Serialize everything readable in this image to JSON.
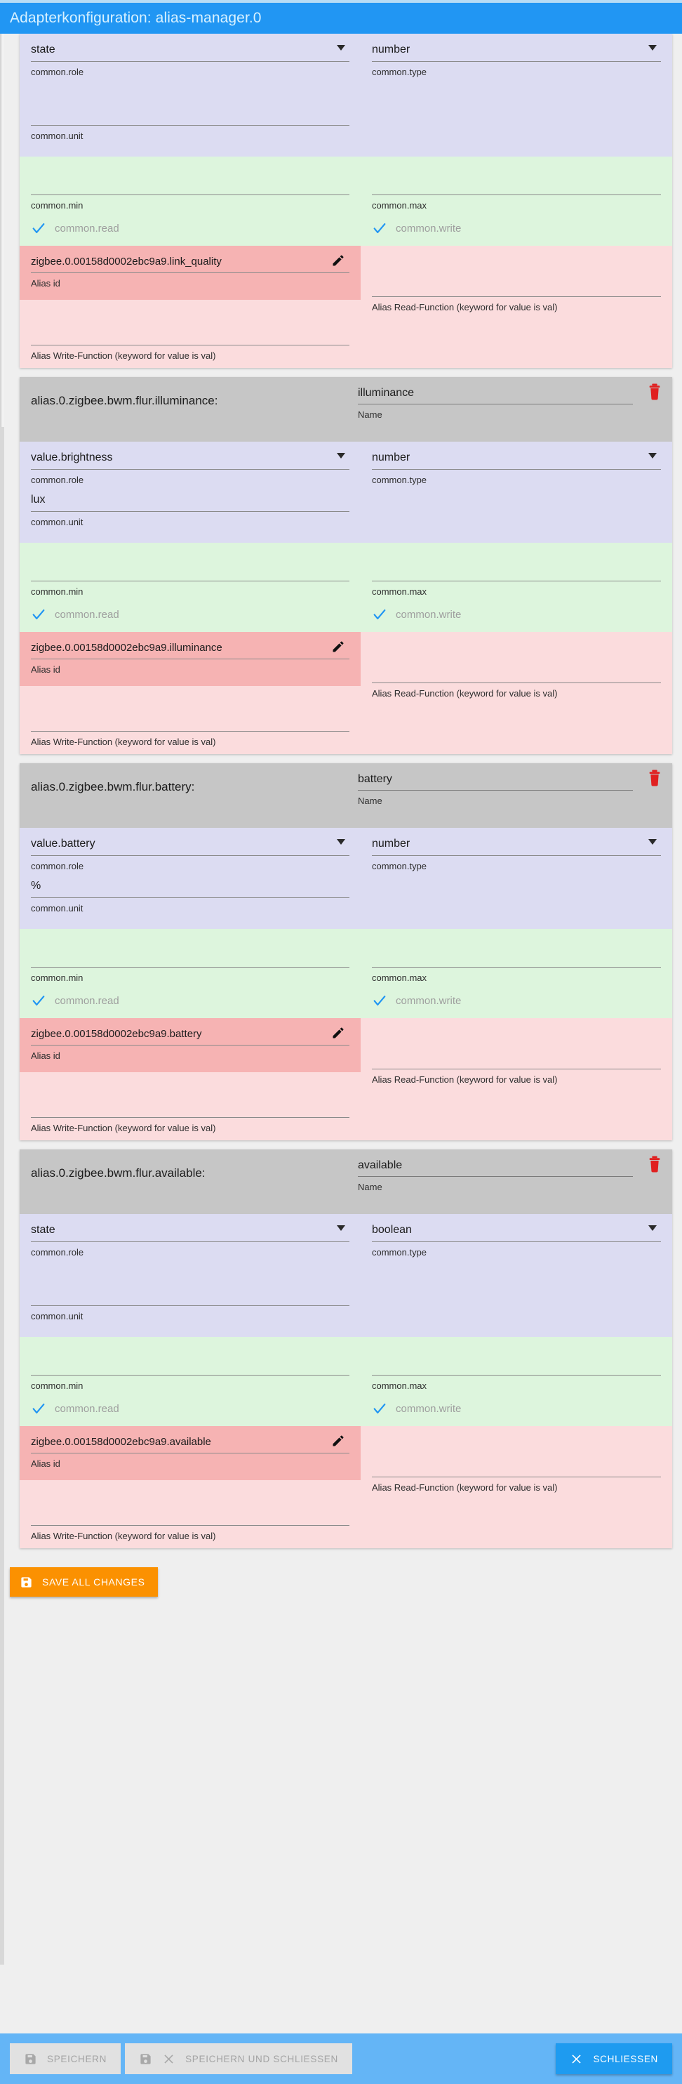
{
  "window": {
    "title": "Adapterkonfiguration: alias-manager.0"
  },
  "labels": {
    "role": "common.role",
    "type": "common.type",
    "unit": "common.unit",
    "min": "common.min",
    "max": "common.max",
    "read": "common.read",
    "write": "common.write",
    "name": "Name",
    "alias_id": "Alias id",
    "alias_read_fn": "Alias Read-Function (keyword for value is val)",
    "alias_write_fn": "Alias Write-Function (keyword for value is val)"
  },
  "icons": {
    "delete": "trash-icon",
    "edit": "pencil-icon",
    "check": "check-icon",
    "save": "floppy-disk-icon",
    "close": "close-x-icon"
  },
  "colors": {
    "accent": "#2196f3",
    "titlebar": "#2196f3",
    "bottombar": "#64b5f6",
    "save_all": "#fb9101",
    "card_head": "#c6c6c6",
    "band_violet": "#dcdcf2",
    "band_green": "#ddf5dd",
    "band_red_light": "#fbdcdd",
    "alias_box": "#f6b3b3",
    "trash_red": "#e02020",
    "check_blue": "#2196f3",
    "close_button": "#1e9bf0"
  },
  "cards": [
    {
      "id": "card-partial",
      "partial": true,
      "header_path": "",
      "name": "",
      "role": "state",
      "type": "number",
      "unit": "",
      "min": "",
      "max": "",
      "read": true,
      "write": true,
      "alias_id": "zigbee.0.00158d0002ebc9a9.link_quality",
      "read_function": "",
      "write_function": ""
    },
    {
      "id": "card-illuminance",
      "partial": false,
      "header_path": "alias.0.zigbee.bwm.flur.illuminance:",
      "name": "illuminance",
      "role": "value.brightness",
      "type": "number",
      "unit": "lux",
      "min": "",
      "max": "",
      "read": true,
      "write": true,
      "alias_id": "zigbee.0.00158d0002ebc9a9.illuminance",
      "read_function": "",
      "write_function": ""
    },
    {
      "id": "card-battery",
      "partial": false,
      "header_path": "alias.0.zigbee.bwm.flur.battery:",
      "name": "battery",
      "role": "value.battery",
      "type": "number",
      "unit": "%",
      "min": "",
      "max": "",
      "read": true,
      "write": true,
      "alias_id": "zigbee.0.00158d0002ebc9a9.battery",
      "read_function": "",
      "write_function": ""
    },
    {
      "id": "card-available",
      "partial": false,
      "header_path": "alias.0.zigbee.bwm.flur.available:",
      "name": "available",
      "role": "state",
      "type": "boolean",
      "unit": "",
      "min": "",
      "max": "",
      "read": true,
      "write": true,
      "alias_id": "zigbee.0.00158d0002ebc9a9.available",
      "read_function": "",
      "write_function": ""
    }
  ],
  "actions": {
    "save_all": "SAVE ALL CHANGES",
    "save": "SPEICHERN",
    "save_and_close": "SPEICHERN UND SCHLIESSEN",
    "close": "SCHLIESSEN"
  }
}
